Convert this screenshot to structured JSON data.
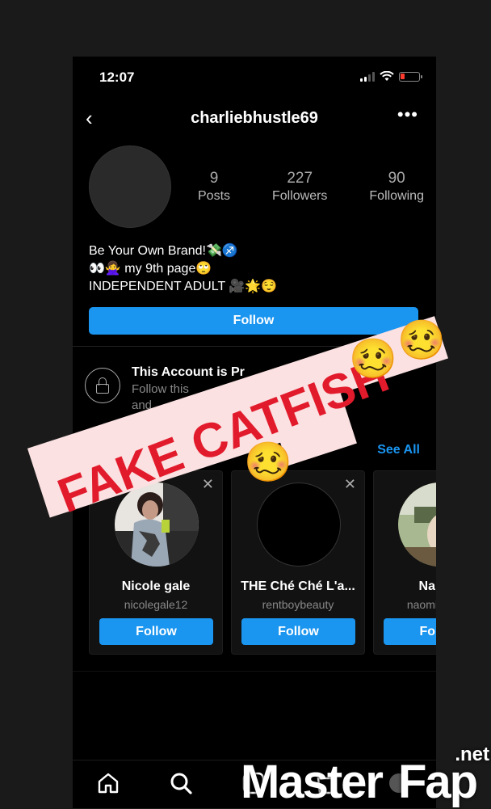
{
  "status_bar": {
    "time": "12:07"
  },
  "header": {
    "username": "charliebhustle69",
    "back_icon": "chevron-left-icon",
    "more_icon": "more-horizontal-icon"
  },
  "stats": [
    {
      "value": "9",
      "label": "Posts"
    },
    {
      "value": "227",
      "label": "Followers"
    },
    {
      "value": "90",
      "label": "Following"
    }
  ],
  "bio": {
    "line1": "Be Your Own Brand!💸♐",
    "line2": "👀🙅‍♀️ my 9th page🙄",
    "line3": "INDEPENDENT ADULT 🎥🌟😌"
  },
  "follow_button": "Follow",
  "private_notice": {
    "title": "This Account is Pr",
    "subtitle_line1": "Follow this",
    "subtitle_line2": "and"
  },
  "suggested": {
    "see_all": "See All"
  },
  "cards": [
    {
      "name": "Nicole gale",
      "handle": "nicolegale12",
      "follow": "Follow"
    },
    {
      "name": "THE Ché Ché L'a...",
      "handle": "rentboybeauty",
      "follow": "Follow"
    },
    {
      "name": "Na",
      "handle": "naomis",
      "follow": "Fo"
    }
  ],
  "overlay": {
    "text": "FAKE CATFISH",
    "emoji": "🥴"
  },
  "watermark": {
    "master": "Master",
    "fap": "Fap",
    "net": ".net"
  },
  "colors": {
    "accent": "#1a95f0",
    "overlay_red": "#e21b2c",
    "overlay_bg": "#fbe1e1"
  },
  "tabbar_icons": [
    "home-icon",
    "search-icon",
    "reels-icon",
    "shop-icon",
    "profile-icon"
  ]
}
